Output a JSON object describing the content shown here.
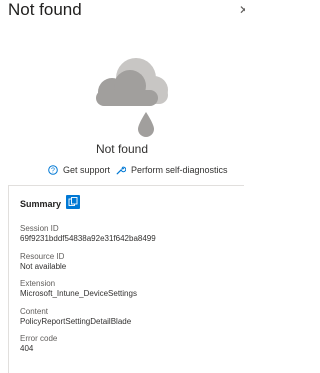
{
  "header": {
    "title": "Not found",
    "close_icon": "close-icon"
  },
  "illustration": {
    "icon": "cloud-with-droplet-icon",
    "colors": {
      "cloud_back": "#c8c6c4",
      "cloud_front": "#a19f9d",
      "droplet": "#a19f9d"
    }
  },
  "message": "Not found",
  "actions": {
    "support_label": "Get support",
    "support_icon": "help-circle-icon",
    "diagnostics_label": "Perform self-diagnostics",
    "diagnostics_icon": "wrench-icon",
    "icon_color": "#0078d4"
  },
  "summary": {
    "title": "Summary",
    "copy_icon": "copy-icon",
    "fields": [
      {
        "label": "Session ID",
        "value": "69f9231bddf54838a92e31f642ba8499"
      },
      {
        "label": "Resource ID",
        "value": "Not available"
      },
      {
        "label": "Extension",
        "value": "Microsoft_Intune_DeviceSettings"
      },
      {
        "label": "Content",
        "value": "PolicyReportSettingDetailBlade"
      },
      {
        "label": "Error code",
        "value": "404"
      }
    ]
  }
}
